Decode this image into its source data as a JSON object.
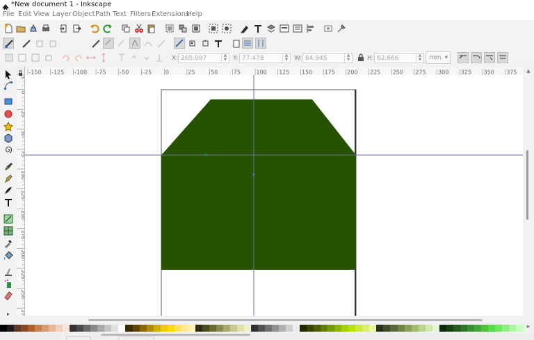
{
  "window": {
    "title": "*New document 1 - Inkscape"
  },
  "menu": [
    "File",
    "Edit",
    "View",
    "Layer",
    "Object",
    "Path",
    "Text",
    "Filters",
    "Extensions",
    "Help"
  ],
  "toolbar": {
    "x_label": "X:",
    "x_value": "265.097",
    "y_label": "Y:",
    "y_value": "77.478",
    "w_label": "W:",
    "w_value": "64.945",
    "h_label": "H:",
    "h_value": "62.666",
    "unit": "mm",
    "unit_caret": "▾"
  },
  "ruler": {
    "h_labels": [
      "-150",
      "-125",
      "-100",
      "-75",
      "-50",
      "-25",
      "0",
      "25",
      "50",
      "75",
      "100",
      "125",
      "150",
      "175",
      "200",
      "225",
      "250",
      "275",
      "300",
      "325",
      "350",
      "375"
    ],
    "v_labels": [
      "-25",
      "0",
      "25",
      "50",
      "75",
      "100",
      "125",
      "150",
      "175",
      "200",
      "225",
      "250",
      "275"
    ]
  },
  "drawing": {
    "shape_fill": "#275200",
    "page_border": "#555555",
    "guide_color": "#6a6fb0"
  },
  "palette": {
    "swatches": [
      "#000000",
      "#1a1a1a",
      "#5a3a2a",
      "#8a4a2a",
      "#b06030",
      "#c8804a",
      "#d89a70",
      "#e8b89a",
      "#f0d0b8",
      "#f8e6da",
      "#333333",
      "#4a4a4a",
      "#6a6a6a",
      "#8a8a8a",
      "#a8a8a8",
      "#c4c4c4",
      "#e0e0e0",
      "#ffffff",
      "#3a2a00",
      "#5a4400",
      "#8a6a00",
      "#b08c00",
      "#d4ac00",
      "#f0c800",
      "#ffd800",
      "#ffe060",
      "#ffe890",
      "#fff0b8",
      "#2a2a10",
      "#4a4a20",
      "#6a6a30",
      "#8a8a50",
      "#aaaa70",
      "#c8c890",
      "#e0e0b0",
      "#f0f0d0",
      "#303030",
      "#505050",
      "#707070",
      "#909090",
      "#b0b0b0",
      "#d0d0d0",
      "#ececec",
      "#202800",
      "#364400",
      "#4c6000",
      "#627c00",
      "#789800",
      "#8eb400",
      "#a4d000",
      "#bae000",
      "#cce840",
      "#dcf070",
      "#eef8a0",
      "#283018",
      "#404c28",
      "#586838",
      "#708448",
      "#88a058",
      "#a0bc70",
      "#b8d490",
      "#d0e8b0",
      "#e8f4d8",
      "#102810",
      "#1a4018",
      "#245a20",
      "#2e7428",
      "#388e30",
      "#42a838",
      "#4cc240",
      "#56dc48",
      "#6ee860",
      "#8cf080",
      "#aaf8a0",
      "#c8ffc0"
    ]
  }
}
